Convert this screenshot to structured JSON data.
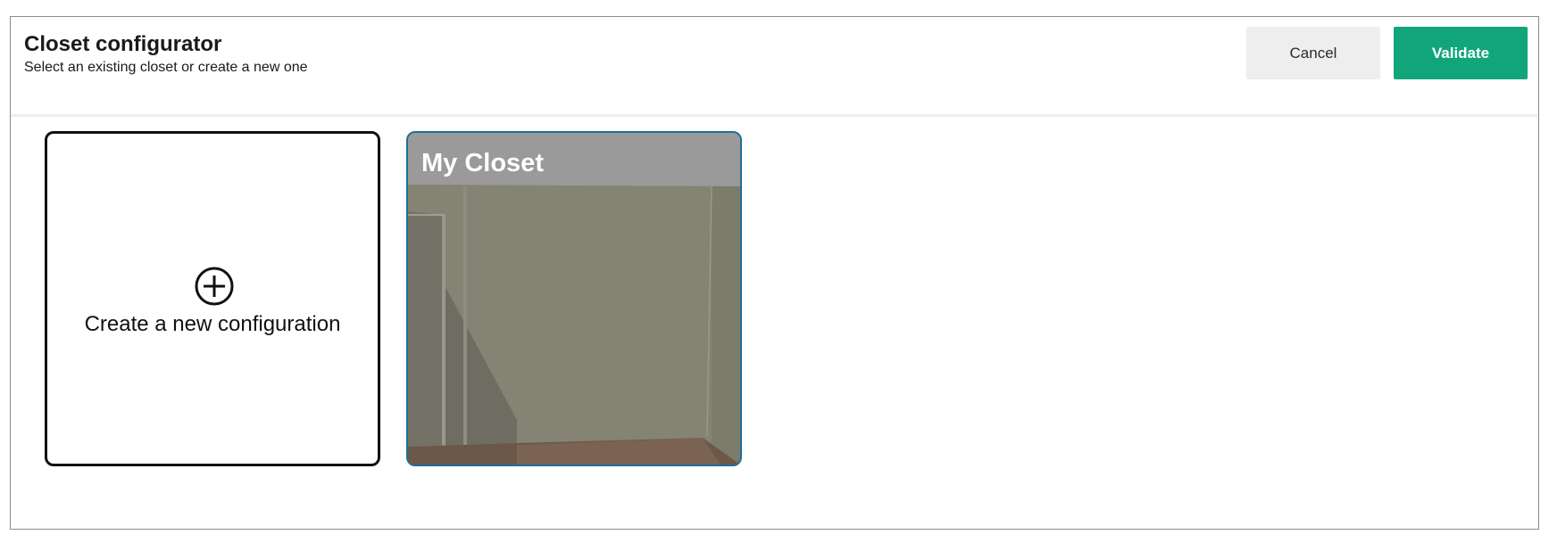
{
  "header": {
    "title": "Closet configurator",
    "subtitle": "Select an existing closet or create a new one",
    "cancel_label": "Cancel",
    "validate_label": "Validate"
  },
  "cards": {
    "new": {
      "label": "Create a new configuration",
      "icon": "plus-circle-icon"
    },
    "existing": [
      {
        "name": "My Closet"
      }
    ]
  },
  "colors": {
    "accent": "#12a57a",
    "selected_border": "#1f6f9a",
    "cancel_bg": "#eeeeee"
  }
}
